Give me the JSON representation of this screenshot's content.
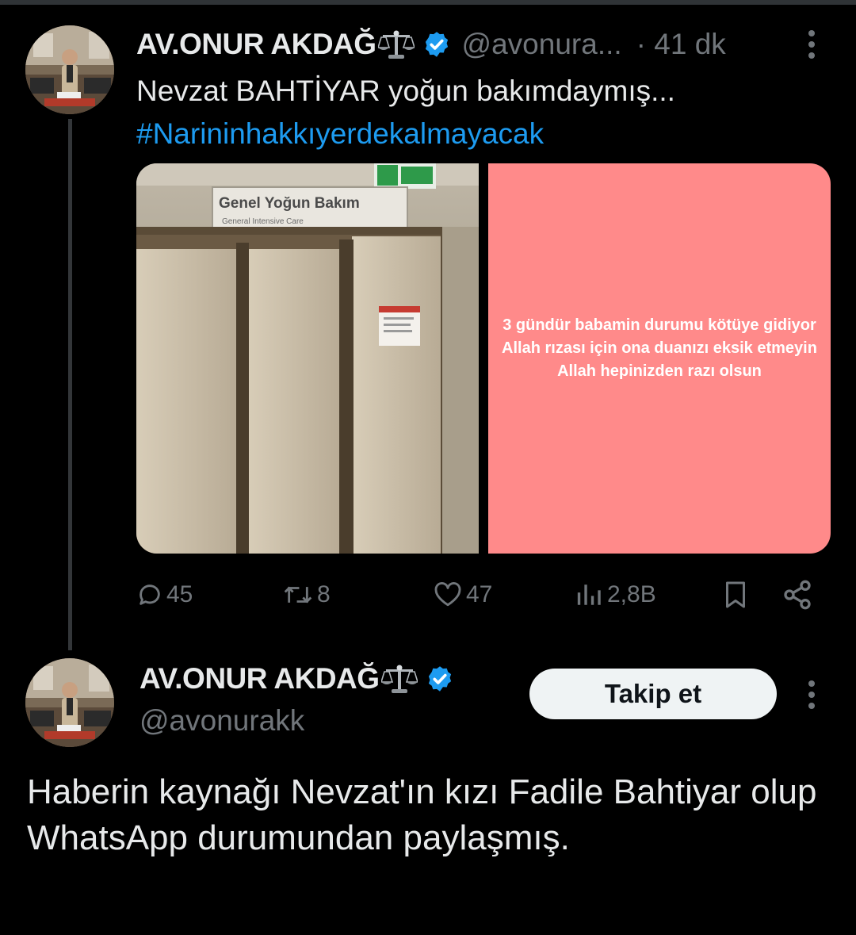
{
  "tweet1": {
    "display_name": "AV.ONUR AKDAĞ",
    "handle": "@avonura...",
    "separator_time": "· 41 dk",
    "text": "Nevzat BAHTİYAR yoğun bakımdaymış...",
    "hashtag": "#Narininhakkıyerdekalmayacak",
    "media_photo": {
      "sign_title": "Genel Yoğun Bakım",
      "sign_subtitle": "General Intensive Care"
    },
    "media_card_text": "3 gündür babamin durumu kötüye gidiyor Allah rızası için ona duanızı eksik etmeyin Allah hepinizden razı olsun",
    "actions": {
      "replies": "45",
      "reposts": "8",
      "likes": "47",
      "views": "2,8B"
    }
  },
  "tweet2": {
    "display_name": "AV.ONUR AKDAĞ",
    "handle": "@avonurakk",
    "follow_label": "Takip et",
    "text": "Haberin kaynağı Nevzat'ın kızı Fadile Bahtiyar olup WhatsApp durumundan paylaşmış."
  },
  "colors": {
    "background": "#000000",
    "text_primary": "#e7e9ea",
    "text_secondary": "#71767b",
    "link": "#1d9bf0",
    "verified": "#1d9bf0",
    "pink_card": "#ff8a8a"
  },
  "icons": [
    "more-icon",
    "verified-badge-icon",
    "scales-emoji-icon",
    "reply-icon",
    "repost-icon",
    "like-icon",
    "views-icon",
    "bookmark-icon",
    "share-icon"
  ]
}
